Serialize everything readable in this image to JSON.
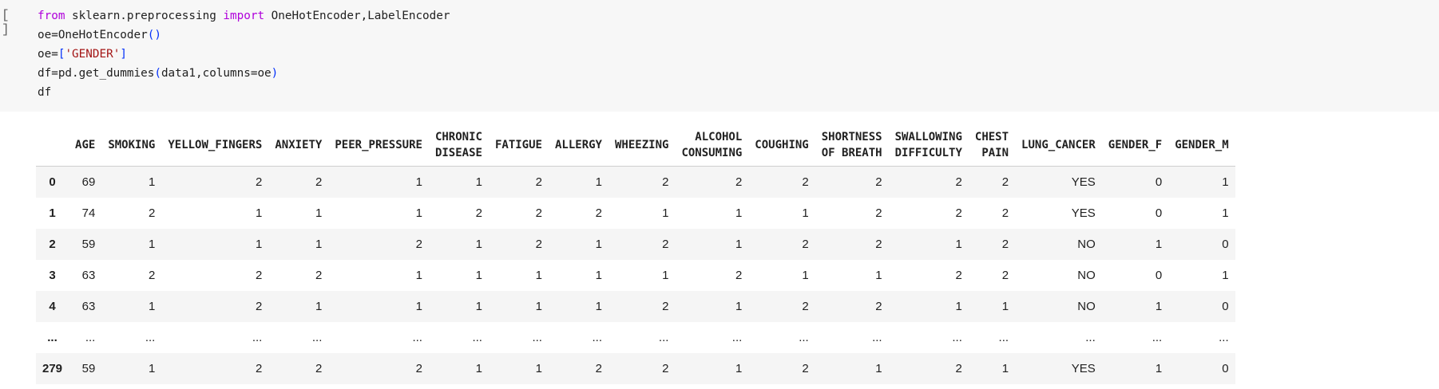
{
  "cell": {
    "run_label": "[ ]",
    "code_lines": [
      "from sklearn.preprocessing import OneHotEncoder,LabelEncoder",
      "oe=OneHotEncoder()",
      "oe=['GENDER']",
      "df=pd.get_dummies(data1,columns=oe)",
      "df"
    ]
  },
  "table": {
    "columns": [
      "",
      "AGE",
      "SMOKING",
      "YELLOW_FINGERS",
      "ANXIETY",
      "PEER_PRESSURE",
      "CHRONIC\nDISEASE",
      "FATIGUE",
      "ALLERGY",
      "WHEEZING",
      "ALCOHOL\nCONSUMING",
      "COUGHING",
      "SHORTNESS\nOF BREATH",
      "SWALLOWING\nDIFFICULTY",
      "CHEST\nPAIN",
      "LUNG_CANCER",
      "GENDER_F",
      "GENDER_M"
    ],
    "rows": [
      [
        "0",
        "69",
        "1",
        "2",
        "2",
        "1",
        "1",
        "2",
        "1",
        "2",
        "2",
        "2",
        "2",
        "2",
        "2",
        "YES",
        "0",
        "1"
      ],
      [
        "1",
        "74",
        "2",
        "1",
        "1",
        "1",
        "2",
        "2",
        "2",
        "1",
        "1",
        "1",
        "2",
        "2",
        "2",
        "YES",
        "0",
        "1"
      ],
      [
        "2",
        "59",
        "1",
        "1",
        "1",
        "2",
        "1",
        "2",
        "1",
        "2",
        "1",
        "2",
        "2",
        "1",
        "2",
        "NO",
        "1",
        "0"
      ],
      [
        "3",
        "63",
        "2",
        "2",
        "2",
        "1",
        "1",
        "1",
        "1",
        "1",
        "2",
        "1",
        "1",
        "2",
        "2",
        "NO",
        "0",
        "1"
      ],
      [
        "4",
        "63",
        "1",
        "2",
        "1",
        "1",
        "1",
        "1",
        "1",
        "2",
        "1",
        "2",
        "2",
        "1",
        "1",
        "NO",
        "1",
        "0"
      ],
      [
        "...",
        "...",
        "...",
        "...",
        "...",
        "...",
        "...",
        "...",
        "...",
        "...",
        "...",
        "...",
        "...",
        "...",
        "...",
        "...",
        "...",
        "..."
      ],
      [
        "279",
        "59",
        "1",
        "2",
        "2",
        "2",
        "1",
        "1",
        "2",
        "2",
        "1",
        "2",
        "1",
        "2",
        "1",
        "YES",
        "1",
        "0"
      ]
    ]
  }
}
